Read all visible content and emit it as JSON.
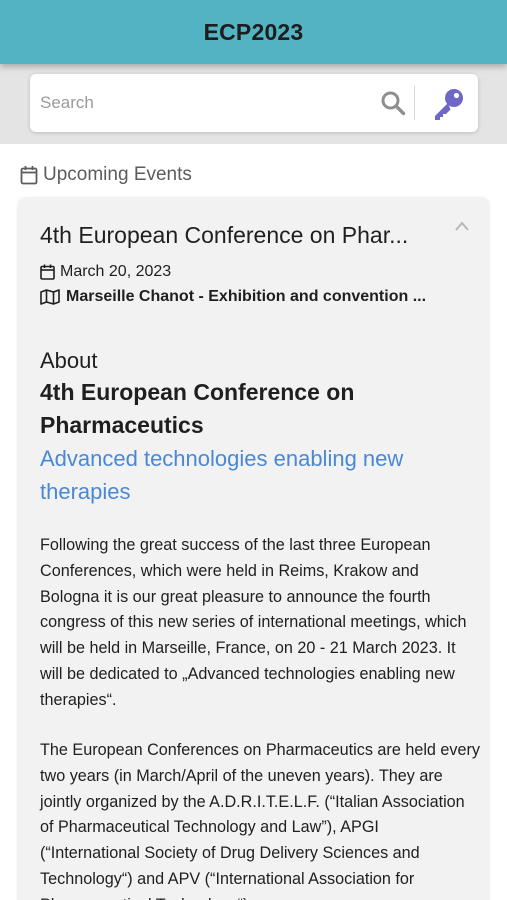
{
  "app": {
    "title": "ECP2023"
  },
  "search": {
    "placeholder": "Search"
  },
  "icons": {
    "search": "search-icon",
    "key": "key-icon",
    "calendar": "calendar-icon",
    "map": "map-icon",
    "chevron": "chevron-up-icon"
  },
  "colors": {
    "header_bg": "#52b3c2",
    "link": "#4a88d6",
    "key_icon": "#6f67c4"
  },
  "section": {
    "title": "Upcoming Events"
  },
  "event": {
    "title": "4th European Conference on Phar...",
    "date": "March 20, 2023",
    "venue": "Marseille Chanot - Exhibition and convention ...",
    "about_heading": "About",
    "about_title": "4th European Conference on Pharmaceutics",
    "about_subtitle": "Advanced technologies enabling new therapies",
    "paragraph1": "Following the great success of the last three European Conferences, which were held in Reims, Krakow and Bologna it is our great pleasure to announce the fourth congress of this new series of international meetings, which will be held in Marseille, France, on 20 - 21 March 2023. It will be dedicated to „Advanced technologies enabling new therapies“.",
    "paragraph2": "The European Conferences on Pharmaceutics are held every two years (in March/April of the uneven years). They are jointly organized by the A.D.R.I.T.E.L.F. (“Italian Association of Pharmaceutical Technology and Law”), APGI (“International Society of Drug Delivery Sciences and Technology“) and APV (“International Association for Pharmaceutical Technology“)."
  }
}
